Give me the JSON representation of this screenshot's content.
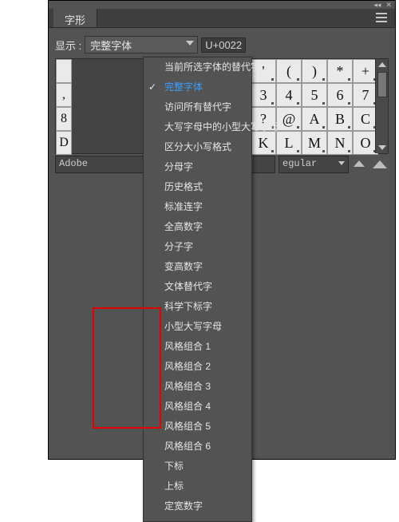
{
  "panel": {
    "title": "字形",
    "ctl_collapse": "◂◂",
    "ctl_close": "✕"
  },
  "toolbar": {
    "show_label": "显示 :",
    "selected_option": "完整字体",
    "unicode": "U+0022"
  },
  "dropdown": {
    "items": [
      "当前所选字体的替代字",
      "完整字体",
      "访问所有替代字",
      "大写字母中的小型大写字母",
      "区分大小写格式",
      "分母字",
      "历史格式",
      "标准连字",
      "全高数字",
      "分子字",
      "变高数字",
      "文体替代字",
      "科学下标字",
      "小型大写字母",
      "风格组合 1",
      "风格组合 2",
      "风格组合 3",
      "风格组合 4",
      "风格组合 5",
      "风格组合 6",
      "下标",
      "上标",
      "定宽数字"
    ],
    "selected_index": 1
  },
  "glyphs": {
    "left_strip": [
      "",
      ",",
      "8",
      "D"
    ],
    "rows": [
      [
        "'",
        "(",
        ")",
        "*",
        "+"
      ],
      [
        "3",
        "4",
        "5",
        "6",
        "7"
      ],
      [
        "?",
        "@",
        "A",
        "B",
        "C"
      ],
      [
        "K",
        "L",
        "M",
        "N",
        "O"
      ]
    ]
  },
  "font": {
    "name": "Adobe ",
    "style": "egular"
  },
  "zoom": {
    "out_label": "缩小",
    "in_label": "放大"
  }
}
